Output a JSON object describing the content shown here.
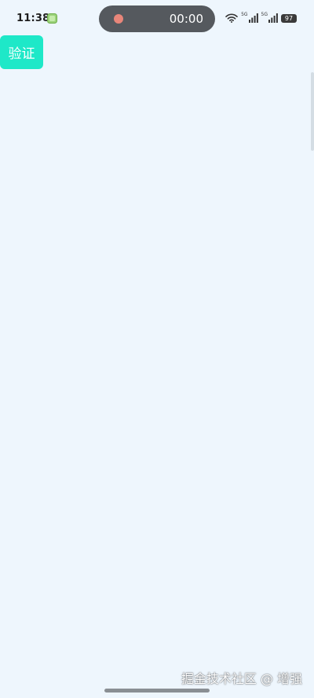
{
  "status_bar": {
    "time": "11:38",
    "recording_timer": "00:00",
    "network_label_1": "5G",
    "network_label_2": "5G",
    "battery_level": "97"
  },
  "main": {
    "verify_button_label": "验证"
  },
  "watermark": "掘金技术社区 @ 增强",
  "colors": {
    "background": "#eef6fd",
    "button": "#1ee8c8",
    "recording_pill": "#55595e",
    "recording_dot": "#e8867a"
  }
}
